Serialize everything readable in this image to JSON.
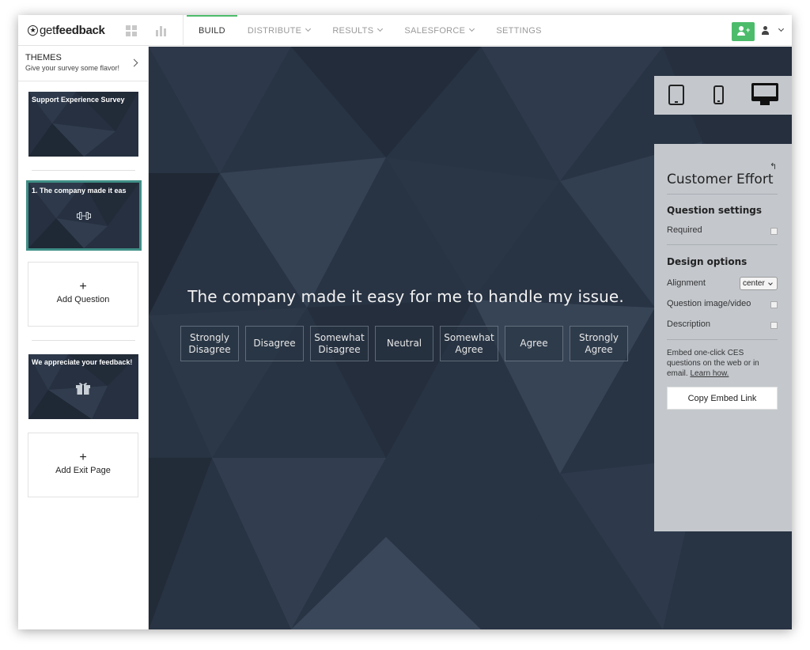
{
  "header": {
    "logo_prefix": "get",
    "logo_bold": "feedback",
    "nav": [
      {
        "label": "BUILD",
        "active": true
      },
      {
        "label": "DISTRIBUTE",
        "dropdown": true
      },
      {
        "label": "RESULTS",
        "dropdown": true
      },
      {
        "label": "SALESFORCE",
        "dropdown": true
      },
      {
        "label": "SETTINGS"
      }
    ],
    "accent_color": "#4cbc6b"
  },
  "sidebar": {
    "themes_title": "THEMES",
    "themes_subtitle": "Give your survey some flavor!",
    "cards": {
      "welcome": "Support Experience Survey",
      "question": "1. The company made it eas",
      "exit": "We appreciate your feedback!"
    },
    "add_question": "Add Question",
    "add_exit_page": "Add Exit Page",
    "plus": "+"
  },
  "canvas": {
    "question": "The company made it easy for me to handle my issue.",
    "options": [
      "Strongly Disagree",
      "Disagree",
      "Somewhat Disagree",
      "Neutral",
      "Somewhat Agree",
      "Agree",
      "Strongly Agree"
    ],
    "background_color": "#283343"
  },
  "panel": {
    "title": "Customer Effort",
    "question_settings": "Question settings",
    "required": "Required",
    "design_options": "Design options",
    "alignment": "Alignment",
    "alignment_value": "center",
    "question_image": "Question image/video",
    "description": "Description",
    "embed_text": "Embed one-click CES questions on the web or in email.",
    "learn_how": "Learn how.",
    "copy_button": "Copy Embed Link"
  }
}
